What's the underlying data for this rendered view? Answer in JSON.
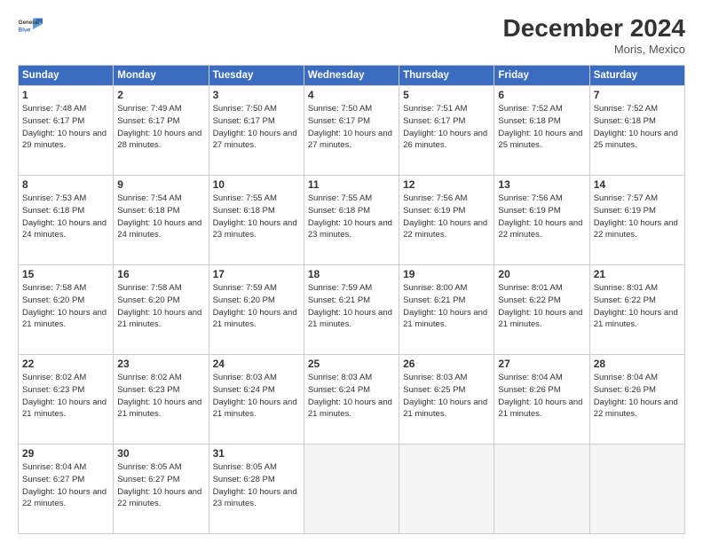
{
  "logo": {
    "line1": "General",
    "line2": "Blue"
  },
  "title": "December 2024",
  "location": "Moris, Mexico",
  "headers": [
    "Sunday",
    "Monday",
    "Tuesday",
    "Wednesday",
    "Thursday",
    "Friday",
    "Saturday"
  ],
  "weeks": [
    [
      {
        "day": "1",
        "sunrise": "7:48 AM",
        "sunset": "6:17 PM",
        "daylight": "10 hours and 29 minutes."
      },
      {
        "day": "2",
        "sunrise": "7:49 AM",
        "sunset": "6:17 PM",
        "daylight": "10 hours and 28 minutes."
      },
      {
        "day": "3",
        "sunrise": "7:50 AM",
        "sunset": "6:17 PM",
        "daylight": "10 hours and 27 minutes."
      },
      {
        "day": "4",
        "sunrise": "7:50 AM",
        "sunset": "6:17 PM",
        "daylight": "10 hours and 27 minutes."
      },
      {
        "day": "5",
        "sunrise": "7:51 AM",
        "sunset": "6:17 PM",
        "daylight": "10 hours and 26 minutes."
      },
      {
        "day": "6",
        "sunrise": "7:52 AM",
        "sunset": "6:18 PM",
        "daylight": "10 hours and 25 minutes."
      },
      {
        "day": "7",
        "sunrise": "7:52 AM",
        "sunset": "6:18 PM",
        "daylight": "10 hours and 25 minutes."
      }
    ],
    [
      {
        "day": "8",
        "sunrise": "7:53 AM",
        "sunset": "6:18 PM",
        "daylight": "10 hours and 24 minutes."
      },
      {
        "day": "9",
        "sunrise": "7:54 AM",
        "sunset": "6:18 PM",
        "daylight": "10 hours and 24 minutes."
      },
      {
        "day": "10",
        "sunrise": "7:55 AM",
        "sunset": "6:18 PM",
        "daylight": "10 hours and 23 minutes."
      },
      {
        "day": "11",
        "sunrise": "7:55 AM",
        "sunset": "6:18 PM",
        "daylight": "10 hours and 23 minutes."
      },
      {
        "day": "12",
        "sunrise": "7:56 AM",
        "sunset": "6:19 PM",
        "daylight": "10 hours and 22 minutes."
      },
      {
        "day": "13",
        "sunrise": "7:56 AM",
        "sunset": "6:19 PM",
        "daylight": "10 hours and 22 minutes."
      },
      {
        "day": "14",
        "sunrise": "7:57 AM",
        "sunset": "6:19 PM",
        "daylight": "10 hours and 22 minutes."
      }
    ],
    [
      {
        "day": "15",
        "sunrise": "7:58 AM",
        "sunset": "6:20 PM",
        "daylight": "10 hours and 21 minutes."
      },
      {
        "day": "16",
        "sunrise": "7:58 AM",
        "sunset": "6:20 PM",
        "daylight": "10 hours and 21 minutes."
      },
      {
        "day": "17",
        "sunrise": "7:59 AM",
        "sunset": "6:20 PM",
        "daylight": "10 hours and 21 minutes."
      },
      {
        "day": "18",
        "sunrise": "7:59 AM",
        "sunset": "6:21 PM",
        "daylight": "10 hours and 21 minutes."
      },
      {
        "day": "19",
        "sunrise": "8:00 AM",
        "sunset": "6:21 PM",
        "daylight": "10 hours and 21 minutes."
      },
      {
        "day": "20",
        "sunrise": "8:01 AM",
        "sunset": "6:22 PM",
        "daylight": "10 hours and 21 minutes."
      },
      {
        "day": "21",
        "sunrise": "8:01 AM",
        "sunset": "6:22 PM",
        "daylight": "10 hours and 21 minutes."
      }
    ],
    [
      {
        "day": "22",
        "sunrise": "8:02 AM",
        "sunset": "6:23 PM",
        "daylight": "10 hours and 21 minutes."
      },
      {
        "day": "23",
        "sunrise": "8:02 AM",
        "sunset": "6:23 PM",
        "daylight": "10 hours and 21 minutes."
      },
      {
        "day": "24",
        "sunrise": "8:03 AM",
        "sunset": "6:24 PM",
        "daylight": "10 hours and 21 minutes."
      },
      {
        "day": "25",
        "sunrise": "8:03 AM",
        "sunset": "6:24 PM",
        "daylight": "10 hours and 21 minutes."
      },
      {
        "day": "26",
        "sunrise": "8:03 AM",
        "sunset": "6:25 PM",
        "daylight": "10 hours and 21 minutes."
      },
      {
        "day": "27",
        "sunrise": "8:04 AM",
        "sunset": "6:26 PM",
        "daylight": "10 hours and 21 minutes."
      },
      {
        "day": "28",
        "sunrise": "8:04 AM",
        "sunset": "6:26 PM",
        "daylight": "10 hours and 22 minutes."
      }
    ],
    [
      {
        "day": "29",
        "sunrise": "8:04 AM",
        "sunset": "6:27 PM",
        "daylight": "10 hours and 22 minutes."
      },
      {
        "day": "30",
        "sunrise": "8:05 AM",
        "sunset": "6:27 PM",
        "daylight": "10 hours and 22 minutes."
      },
      {
        "day": "31",
        "sunrise": "8:05 AM",
        "sunset": "6:28 PM",
        "daylight": "10 hours and 23 minutes."
      },
      null,
      null,
      null,
      null
    ]
  ]
}
